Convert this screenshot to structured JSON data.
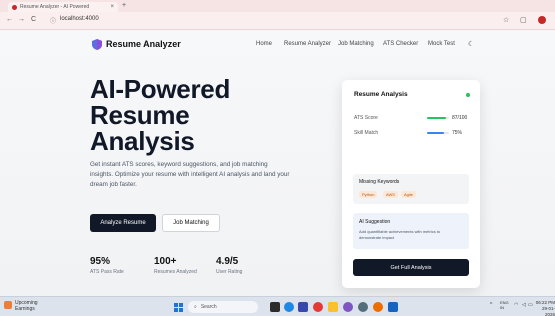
{
  "browser": {
    "tab_title": "Resume Analyzer - AI Powered",
    "tab_close": "×",
    "new_tab": "+",
    "url": "localhost:4000",
    "url_icon": "ⓘ",
    "back": "←",
    "forward": "→",
    "reload": "C",
    "star": "☆",
    "extensions": "▢"
  },
  "header": {
    "brand": "Resume Analyzer",
    "nav": [
      "Home",
      "Resume Analyzer",
      "Job Matching",
      "ATS Checker",
      "Mock Test"
    ],
    "theme_toggle": "☾"
  },
  "hero": {
    "title_line1": "AI-Powered",
    "title_line2": "Resume",
    "title_line3": "Analysis",
    "description": "Get instant ATS scores, keyword suggestions, and job matching insights. Optimize your resume with intelligent AI analysis and land your dream job faster.",
    "primary_button": "Analyze Resume",
    "secondary_button": "Job Matching"
  },
  "stats": [
    {
      "value": "95%",
      "label": "ATS Pass Rate"
    },
    {
      "value": "100+",
      "label": "Resumes Analyzed"
    },
    {
      "value": "4.9/5",
      "label": "User Rating"
    }
  ],
  "card": {
    "title": "Resume Analysis",
    "ats_label": "ATS Score",
    "ats_value": "87/100",
    "ats_fraction": 0.87,
    "skill_label": "Skill Match",
    "skill_value": "75%",
    "skill_fraction": 0.75,
    "keywords_title": "Missing Keywords",
    "keywords": [
      "Python",
      "AWS",
      "Agile"
    ],
    "suggestion_title": "AI Suggestion",
    "suggestion_text": "Add quantifiable achievements with metrics to demonstrate impact",
    "button": "Get Full Analysis",
    "colors": {
      "ats": "#22c55e",
      "skill": "#3b82f6",
      "status_dot": "#22c55e"
    }
  },
  "taskbar": {
    "weather_title": "Upcoming",
    "weather_sub": "Earnings",
    "search_placeholder": "Search",
    "search_icon": "⌕",
    "tray_lang_top": "ENG",
    "tray_lang_bottom": "IN",
    "time": "06:22 PM",
    "date": "29-01-2026"
  }
}
